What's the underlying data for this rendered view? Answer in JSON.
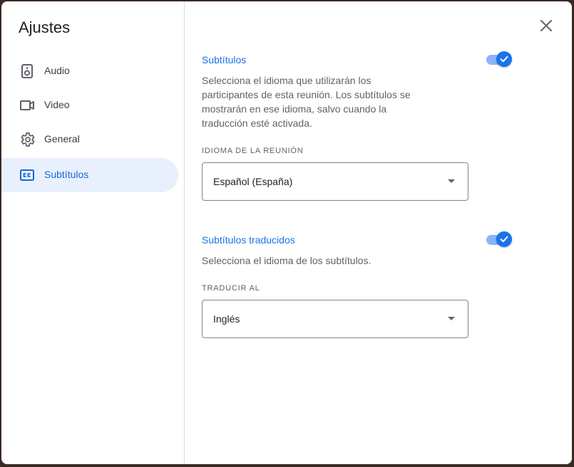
{
  "dialog": {
    "title": "Ajustes",
    "close_icon": "close-icon"
  },
  "sidebar": {
    "items": [
      {
        "label": "Audio",
        "icon": "speaker-icon"
      },
      {
        "label": "Video",
        "icon": "video-camera-icon"
      },
      {
        "label": "General",
        "icon": "gear-icon"
      },
      {
        "label": "Subtítulos",
        "icon": "closed-captions-icon",
        "active": true
      }
    ]
  },
  "captions": {
    "title": "Subtítulos",
    "enabled": true,
    "description": "Selecciona el idioma que utilizarán los participantes de esta reunión. Los subtítulos se mostrarán en ese idioma, salvo cuando la traducción esté activada.",
    "field_label": "IDIOMA DE LA REUNIÓN",
    "selected_language": "Español (España)"
  },
  "translated": {
    "title": "Subtítulos traducidos",
    "enabled": true,
    "description": "Selecciona el idioma de los subtítulos.",
    "field_label": "TRADUCIR AL",
    "selected_language": "Inglés"
  },
  "colors": {
    "accent": "#1a73e8",
    "active_nav_bg": "#e8f0fe",
    "toggle_track": "#8ab4f8"
  }
}
